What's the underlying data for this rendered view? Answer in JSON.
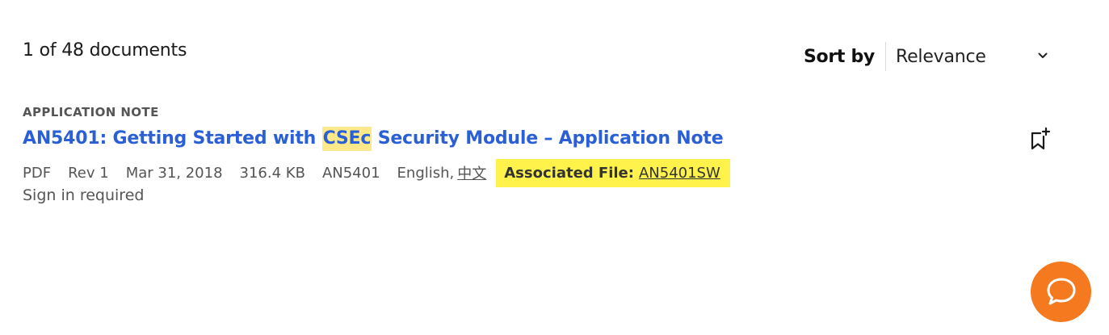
{
  "results": {
    "count_text": "1 of 48 documents"
  },
  "sort": {
    "label": "Sort by",
    "selected": "Relevance"
  },
  "document": {
    "type": "APPLICATION NOTE",
    "title_before": "AN5401: Getting Started with ",
    "title_highlight": "CSEc",
    "title_after": " Security Module – Application Note",
    "format": "PDF",
    "revision": "Rev 1",
    "date": "Mar 31, 2018",
    "size": "316.4 KB",
    "doc_id": "AN5401",
    "language": "English,",
    "language_alt": "中文",
    "associated_file_label": "Associated File:",
    "associated_file_link": "AN5401SW",
    "access_note": "Sign in required"
  },
  "colors": {
    "title_link": "#2a5fd6",
    "term_highlight": "#fde98a",
    "associated_highlight": "#fff24a",
    "chat_button": "#f57a1f"
  },
  "icons": {
    "sort": "chevron-down-icon",
    "bookmark": "bookmark-add-icon",
    "chat": "chat-bubble-icon"
  }
}
